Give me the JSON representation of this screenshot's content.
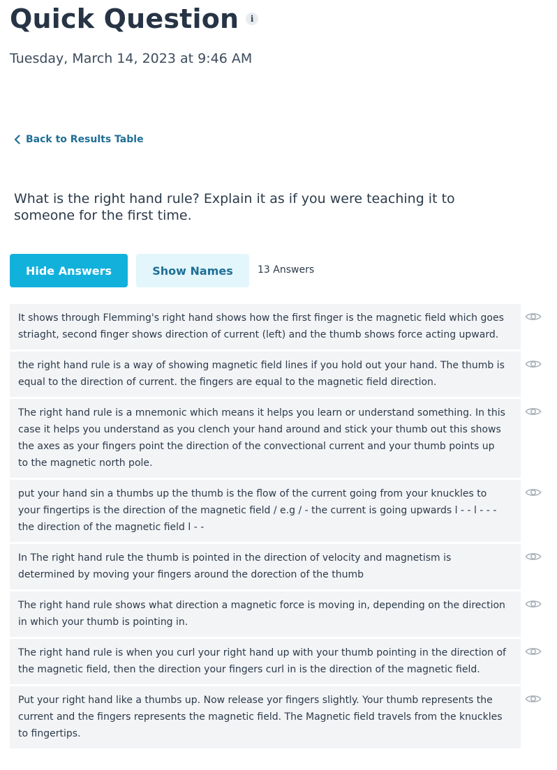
{
  "header": {
    "title": "Quick Question",
    "info_icon": "info-icon",
    "date": "Tuesday, March 14, 2023 at 9:46 AM"
  },
  "nav": {
    "back_label": "Back to Results Table"
  },
  "question": {
    "text": "What is the right hand rule? Explain it as if you were teaching it to someone for the first time."
  },
  "controls": {
    "hide_answers_label": "Hide Answers",
    "show_names_label": "Show Names",
    "answer_count": "13 Answers"
  },
  "colors": {
    "primary": "#12b1dc",
    "primary_light": "#e3f6fc",
    "link": "#1f6f96",
    "answer_bg": "#f3f4f6",
    "text": "#2b3a4a"
  },
  "answers": [
    {
      "text": "It shows through Flemming's right hand shows how the first finger is the magnetic field which goes striaght, second finger shows direction of current (left) and the thumb shows force acting upward.",
      "icon": "eye-icon"
    },
    {
      "text": "the right hand rule is a way of showing magnetic field lines if you hold out your hand. The thumb is equal to the direction of current. the fingers are equal to the magnetic field direction.",
      "icon": "eye-icon"
    },
    {
      "text": "The right hand rule is a mnemonic which means it helps you learn or understand something. In this case it helps you understand as you clench your hand around and stick your thumb out this shows the axes as your fingers point the direction of the convectional current and your thumb points up to the magnetic north pole.",
      "icon": "eye-icon"
    },
    {
      "text": "put your hand sin a thumbs up the thumb is the flow of the current going from your knuckles to your fingertips is the direction of the magnetic field / e.g / - the current is going upwards l - - l - - - the direction of the magnetic field l - -",
      "icon": "eye-icon"
    },
    {
      "text": "In The right hand rule the thumb is pointed in the direction of velocity and magnetism is determined by moving your fingers around the dorection of the thumb",
      "icon": "eye-icon"
    },
    {
      "text": "The right hand rule shows what direction a magnetic force is moving in, depending on the direction in which your thumb is pointing in.",
      "icon": "eye-icon"
    },
    {
      "text": "The right hand rule is when you curl your right hand up with your thumb pointing in the direction of the magnetic field, then the direction your fingers curl in is the direction of the magnetic field.",
      "icon": "eye-icon"
    },
    {
      "text": "Put your right hand like a thumbs up. Now release yor fingers slightly. Your thumb represents the current and the fingers represents the magnetic field. The Magnetic field travels from the knuckles to fingertips.",
      "icon": "eye-icon"
    }
  ]
}
